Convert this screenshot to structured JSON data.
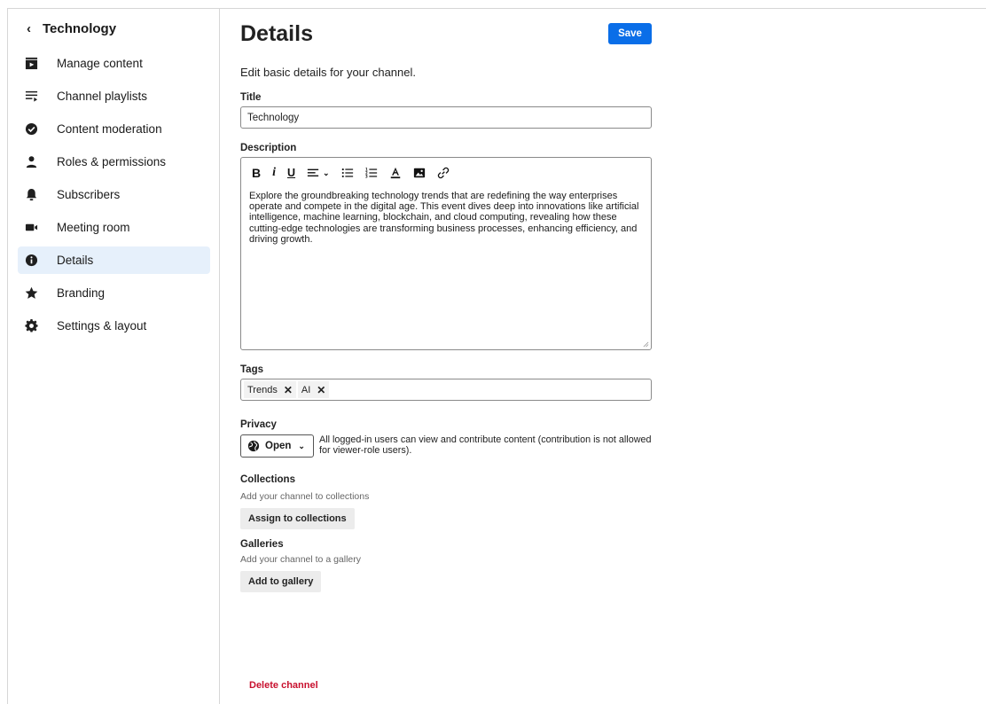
{
  "sidebar": {
    "back_label": "Technology",
    "items": [
      {
        "label": "Manage content",
        "icon": "manage-content-icon"
      },
      {
        "label": "Channel playlists",
        "icon": "playlist-icon"
      },
      {
        "label": "Content moderation",
        "icon": "check-circle-icon"
      },
      {
        "label": "Roles & permissions",
        "icon": "person-icon"
      },
      {
        "label": "Subscribers",
        "icon": "bell-icon"
      },
      {
        "label": "Meeting room",
        "icon": "video-camera-icon"
      },
      {
        "label": "Details",
        "icon": "info-icon",
        "active": true
      },
      {
        "label": "Branding",
        "icon": "star-icon"
      },
      {
        "label": "Settings & layout",
        "icon": "gear-icon"
      }
    ]
  },
  "main": {
    "title": "Details",
    "save_label": "Save",
    "subtitle": "Edit basic details for your channel.",
    "title_label": "Title",
    "title_value": "Technology",
    "description_label": "Description",
    "description_text": "Explore the groundbreaking technology trends that are redefining the way enterprises operate and compete in the digital age. This event dives deep into innovations like artificial intelligence, machine learning, blockchain, and cloud computing, revealing how these cutting-edge technologies are transforming business processes, enhancing efficiency, and driving growth.",
    "tags_label": "Tags",
    "tags": [
      "Trends",
      "AI"
    ],
    "privacy_label": "Privacy",
    "privacy_value": "Open",
    "privacy_description": "All logged-in users can view and contribute content (contribution is not allowed for viewer-role users).",
    "collections_label": "Collections",
    "collections_hint": "Add your channel to collections",
    "collections_button": "Assign to collections",
    "galleries_label": "Galleries",
    "galleries_hint": "Add your channel to a gallery",
    "galleries_button": "Add to gallery",
    "delete_label": "Delete channel"
  },
  "colors": {
    "accent": "#0a6ee8",
    "active_nav_bg": "#e6f0fb",
    "danger": "#c8102e"
  }
}
